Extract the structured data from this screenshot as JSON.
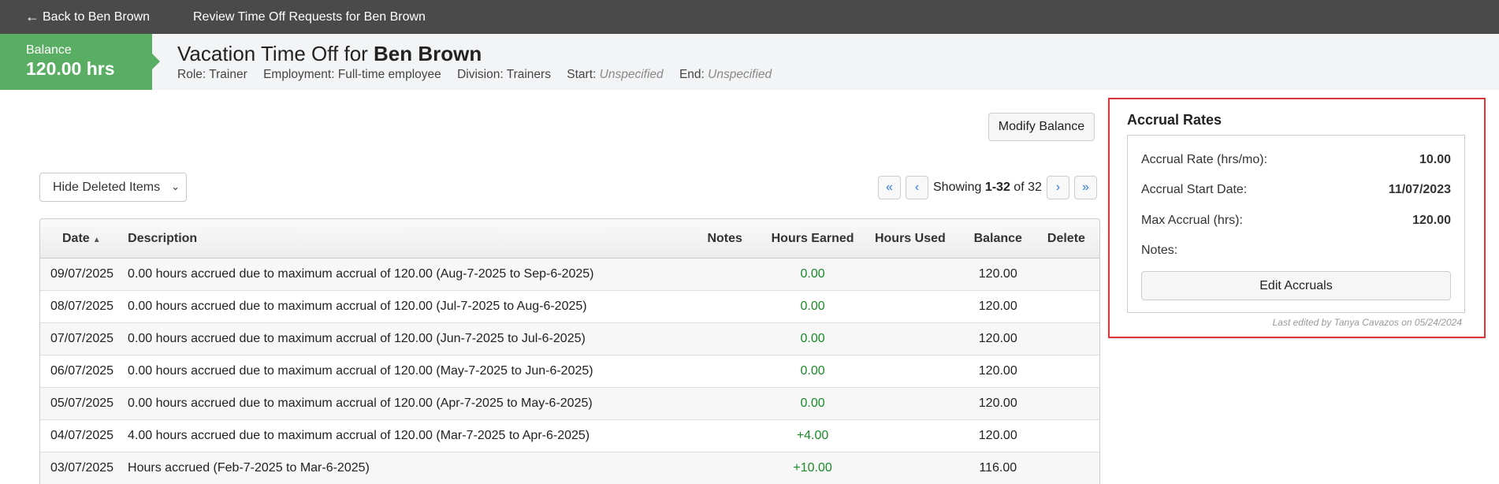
{
  "topbar": {
    "back_label": "Back to Ben Brown",
    "crumb": "Review Time Off Requests for Ben Brown"
  },
  "balance": {
    "label": "Balance",
    "value": "120.00 hrs"
  },
  "header": {
    "title_prefix": "Vacation Time Off for ",
    "title_name": "Ben Brown",
    "role_label": "Role:",
    "role_value": "Trainer",
    "employment_label": "Employment:",
    "employment_value": "Full-time employee",
    "division_label": "Division:",
    "division_value": "Trainers",
    "start_label": "Start:",
    "start_value": "Unspecified",
    "end_label": "End:",
    "end_value": "Unspecified"
  },
  "actions": {
    "modify_balance": "Modify Balance",
    "filter_selected": "Hide Deleted Items"
  },
  "pager": {
    "showing_prefix": "Showing ",
    "showing_range": "1-32",
    "showing_suffix": " of 32"
  },
  "table": {
    "columns": [
      "Date",
      "Description",
      "Notes",
      "Hours Earned",
      "Hours Used",
      "Balance",
      "Delete"
    ],
    "rows": [
      {
        "date": "09/07/2025",
        "desc": "0.00 hours accrued due to maximum accrual of 120.00 (Aug-7-2025 to Sep-6-2025)",
        "notes": "",
        "earned": "0.00",
        "used": "",
        "balance": "120.00"
      },
      {
        "date": "08/07/2025",
        "desc": "0.00 hours accrued due to maximum accrual of 120.00 (Jul-7-2025 to Aug-6-2025)",
        "notes": "",
        "earned": "0.00",
        "used": "",
        "balance": "120.00"
      },
      {
        "date": "07/07/2025",
        "desc": "0.00 hours accrued due to maximum accrual of 120.00 (Jun-7-2025 to Jul-6-2025)",
        "notes": "",
        "earned": "0.00",
        "used": "",
        "balance": "120.00"
      },
      {
        "date": "06/07/2025",
        "desc": "0.00 hours accrued due to maximum accrual of 120.00 (May-7-2025 to Jun-6-2025)",
        "notes": "",
        "earned": "0.00",
        "used": "",
        "balance": "120.00"
      },
      {
        "date": "05/07/2025",
        "desc": "0.00 hours accrued due to maximum accrual of 120.00 (Apr-7-2025 to May-6-2025)",
        "notes": "",
        "earned": "0.00",
        "used": "",
        "balance": "120.00"
      },
      {
        "date": "04/07/2025",
        "desc": "4.00 hours accrued due to maximum accrual of 120.00 (Mar-7-2025 to Apr-6-2025)",
        "notes": "",
        "earned": "+4.00",
        "used": "",
        "balance": "120.00"
      },
      {
        "date": "03/07/2025",
        "desc": "Hours accrued (Feb-7-2025 to Mar-6-2025)",
        "notes": "",
        "earned": "+10.00",
        "used": "",
        "balance": "116.00"
      }
    ]
  },
  "accrual": {
    "title": "Accrual Rates",
    "rate_label": "Accrual Rate (hrs/mo):",
    "rate_value": "10.00",
    "start_label": "Accrual Start Date:",
    "start_value": "11/07/2023",
    "max_label": "Max Accrual (hrs):",
    "max_value": "120.00",
    "notes_label": "Notes:",
    "edit_button": "Edit Accruals",
    "last_edited": "Last edited by Tanya Cavazos on 05/24/2024"
  },
  "colors": {
    "topbar": "#4a4a4a",
    "balance_green": "#5aae63",
    "earned_green": "#1a8a2a",
    "highlight_red": "#d9363e",
    "pager_blue": "#2e7bd6"
  },
  "icons": {
    "back": "left-arrow-icon",
    "first": "double-chevron-left-icon",
    "prev": "chevron-left-icon",
    "next": "chevron-right-icon",
    "last": "double-chevron-right-icon",
    "sort": "sort-ascending-icon"
  }
}
